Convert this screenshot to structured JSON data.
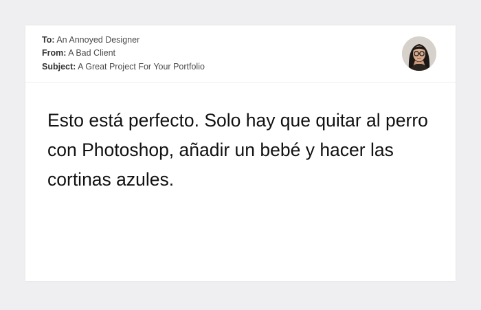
{
  "email": {
    "to_label": "To:",
    "to_value": "An Annoyed Designer",
    "from_label": "From:",
    "from_value": "A Bad Client",
    "subject_label": "Subject:",
    "subject_value": "A Great Project For Your Portfolio",
    "avatar_icon": "user-avatar-photo",
    "body_text": "Esto está perfecto. Solo hay que quitar al perro con Photoshop, añadir un bebé y hacer las cortinas azules."
  },
  "colors": {
    "page_background": "#efeff1",
    "card_background": "#ffffff",
    "body_text": "#111111",
    "meta_text": "#4a4a4a"
  }
}
